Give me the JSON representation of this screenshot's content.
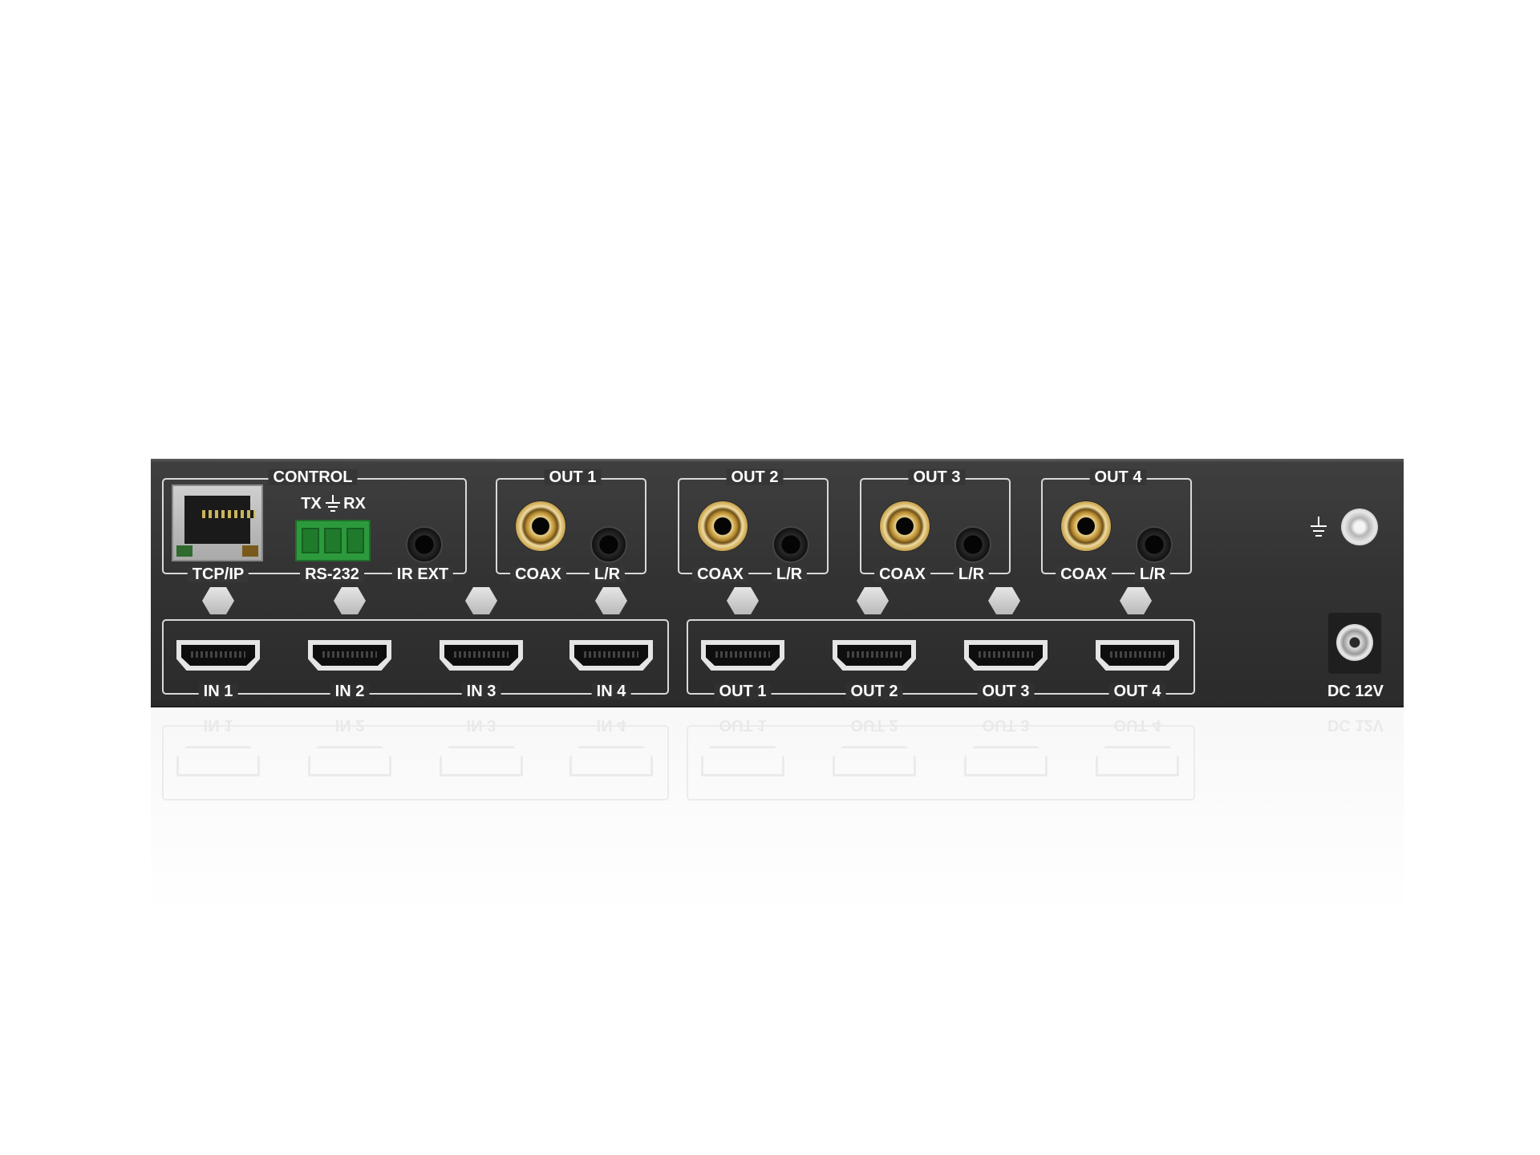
{
  "control": {
    "group_label": "CONTROL",
    "serial_pins_tx": "TX",
    "serial_pins_rx": "RX",
    "tcpip_label": "TCP/IP",
    "rs232_label": "RS-232",
    "ir_ext_label": "IR EXT"
  },
  "audio_outputs": [
    {
      "title": "OUT 1",
      "coax_label": "COAX",
      "lr_label": "L/R"
    },
    {
      "title": "OUT 2",
      "coax_label": "COAX",
      "lr_label": "L/R"
    },
    {
      "title": "OUT 3",
      "coax_label": "COAX",
      "lr_label": "L/R"
    },
    {
      "title": "OUT 4",
      "coax_label": "COAX",
      "lr_label": "L/R"
    }
  ],
  "hdmi_inputs": [
    "IN 1",
    "IN 2",
    "IN 3",
    "IN 4"
  ],
  "hdmi_outputs": [
    "OUT 1",
    "OUT 2",
    "OUT 3",
    "OUT 4"
  ],
  "power": {
    "label": "DC 12V"
  },
  "icons": {
    "ground": "ground-symbol-icon"
  },
  "colors": {
    "panel": "#333333",
    "label": "#ffffff",
    "frame": "#d9d9d9",
    "terminal_green": "#2c9a3c",
    "rca_gold": "#c7a24b"
  }
}
